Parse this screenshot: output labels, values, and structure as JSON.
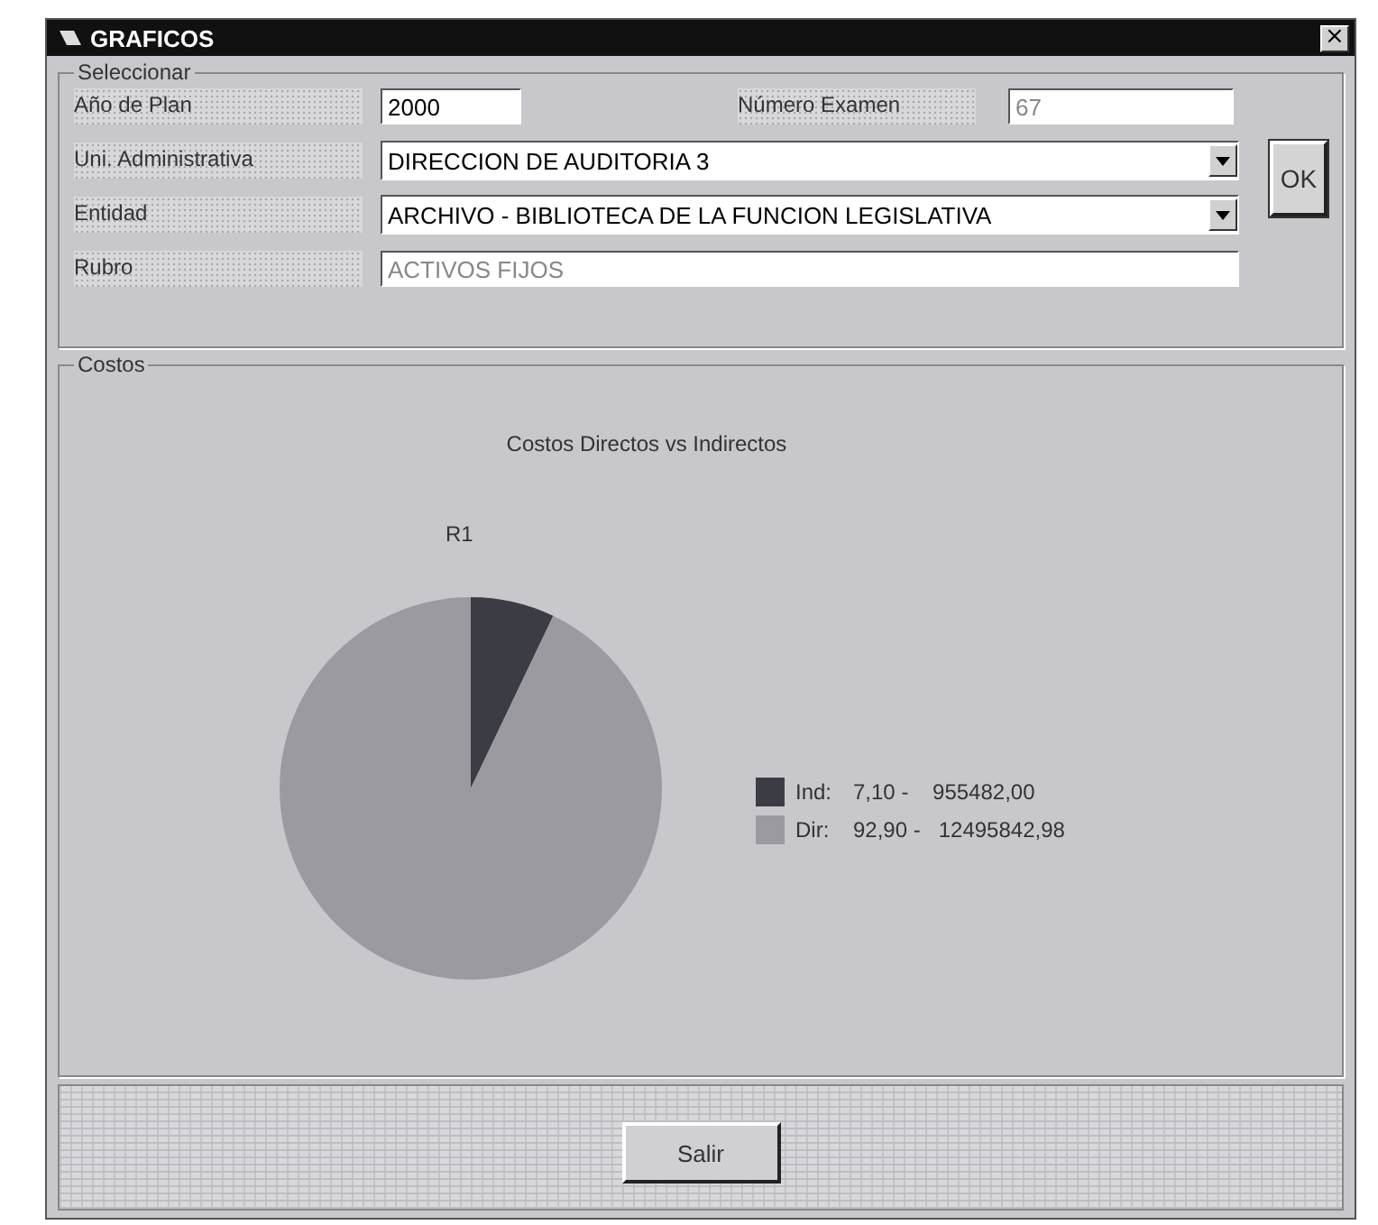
{
  "window": {
    "title": "GRAFICOS",
    "close": "×"
  },
  "seleccionar": {
    "title": "Seleccionar",
    "ano_plan": {
      "label": "Año de Plan",
      "value": "2000"
    },
    "numero_examen": {
      "label": "Número Examen",
      "value": "67",
      "disabled": true
    },
    "uni_administrativa": {
      "label": "Uni. Administrativa",
      "value": "DIRECCION DE AUDITORIA 3"
    },
    "entidad": {
      "label": "Entidad",
      "value": "ARCHIVO - BIBLIOTECA DE LA FUNCION LEGISLATIVA"
    },
    "rubro": {
      "label": "Rubro",
      "value": "ACTIVOS FIJOS",
      "disabled": true
    },
    "ok_button": "OK"
  },
  "costos": {
    "title": "Costos",
    "legend": [
      {
        "label": "Ind:",
        "text": "7,10 -    955482,00",
        "color": "#3c3c44"
      },
      {
        "label": "Dir:",
        "text": "92,90 -   12495842,98",
        "color": "#9a9aa0"
      }
    ],
    "chart_data": {
      "type": "pie",
      "title": "Costos Directos vs Indirectos",
      "series": [
        {
          "name": "R1",
          "values": [
            7.1,
            92.9
          ]
        }
      ]
    }
  },
  "buttons": [
    "Salir"
  ]
}
